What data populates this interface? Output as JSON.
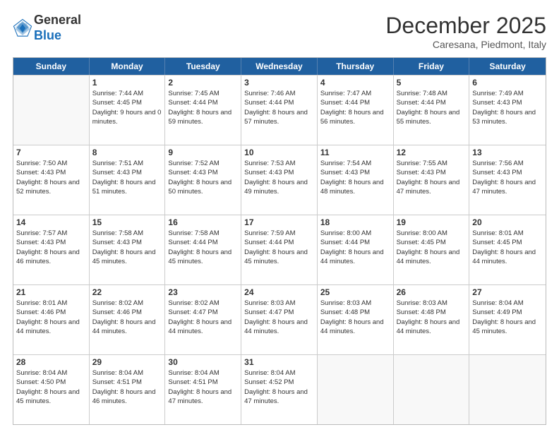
{
  "logo": {
    "general": "General",
    "blue": "Blue"
  },
  "header": {
    "month": "December 2025",
    "location": "Caresana, Piedmont, Italy"
  },
  "weekdays": [
    "Sunday",
    "Monday",
    "Tuesday",
    "Wednesday",
    "Thursday",
    "Friday",
    "Saturday"
  ],
  "rows": [
    [
      {
        "day": "",
        "sunrise": "",
        "sunset": "",
        "daylight": ""
      },
      {
        "day": "1",
        "sunrise": "Sunrise: 7:44 AM",
        "sunset": "Sunset: 4:45 PM",
        "daylight": "Daylight: 9 hours and 0 minutes."
      },
      {
        "day": "2",
        "sunrise": "Sunrise: 7:45 AM",
        "sunset": "Sunset: 4:44 PM",
        "daylight": "Daylight: 8 hours and 59 minutes."
      },
      {
        "day": "3",
        "sunrise": "Sunrise: 7:46 AM",
        "sunset": "Sunset: 4:44 PM",
        "daylight": "Daylight: 8 hours and 57 minutes."
      },
      {
        "day": "4",
        "sunrise": "Sunrise: 7:47 AM",
        "sunset": "Sunset: 4:44 PM",
        "daylight": "Daylight: 8 hours and 56 minutes."
      },
      {
        "day": "5",
        "sunrise": "Sunrise: 7:48 AM",
        "sunset": "Sunset: 4:44 PM",
        "daylight": "Daylight: 8 hours and 55 minutes."
      },
      {
        "day": "6",
        "sunrise": "Sunrise: 7:49 AM",
        "sunset": "Sunset: 4:43 PM",
        "daylight": "Daylight: 8 hours and 53 minutes."
      }
    ],
    [
      {
        "day": "7",
        "sunrise": "Sunrise: 7:50 AM",
        "sunset": "Sunset: 4:43 PM",
        "daylight": "Daylight: 8 hours and 52 minutes."
      },
      {
        "day": "8",
        "sunrise": "Sunrise: 7:51 AM",
        "sunset": "Sunset: 4:43 PM",
        "daylight": "Daylight: 8 hours and 51 minutes."
      },
      {
        "day": "9",
        "sunrise": "Sunrise: 7:52 AM",
        "sunset": "Sunset: 4:43 PM",
        "daylight": "Daylight: 8 hours and 50 minutes."
      },
      {
        "day": "10",
        "sunrise": "Sunrise: 7:53 AM",
        "sunset": "Sunset: 4:43 PM",
        "daylight": "Daylight: 8 hours and 49 minutes."
      },
      {
        "day": "11",
        "sunrise": "Sunrise: 7:54 AM",
        "sunset": "Sunset: 4:43 PM",
        "daylight": "Daylight: 8 hours and 48 minutes."
      },
      {
        "day": "12",
        "sunrise": "Sunrise: 7:55 AM",
        "sunset": "Sunset: 4:43 PM",
        "daylight": "Daylight: 8 hours and 47 minutes."
      },
      {
        "day": "13",
        "sunrise": "Sunrise: 7:56 AM",
        "sunset": "Sunset: 4:43 PM",
        "daylight": "Daylight: 8 hours and 47 minutes."
      }
    ],
    [
      {
        "day": "14",
        "sunrise": "Sunrise: 7:57 AM",
        "sunset": "Sunset: 4:43 PM",
        "daylight": "Daylight: 8 hours and 46 minutes."
      },
      {
        "day": "15",
        "sunrise": "Sunrise: 7:58 AM",
        "sunset": "Sunset: 4:43 PM",
        "daylight": "Daylight: 8 hours and 45 minutes."
      },
      {
        "day": "16",
        "sunrise": "Sunrise: 7:58 AM",
        "sunset": "Sunset: 4:44 PM",
        "daylight": "Daylight: 8 hours and 45 minutes."
      },
      {
        "day": "17",
        "sunrise": "Sunrise: 7:59 AM",
        "sunset": "Sunset: 4:44 PM",
        "daylight": "Daylight: 8 hours and 45 minutes."
      },
      {
        "day": "18",
        "sunrise": "Sunrise: 8:00 AM",
        "sunset": "Sunset: 4:44 PM",
        "daylight": "Daylight: 8 hours and 44 minutes."
      },
      {
        "day": "19",
        "sunrise": "Sunrise: 8:00 AM",
        "sunset": "Sunset: 4:45 PM",
        "daylight": "Daylight: 8 hours and 44 minutes."
      },
      {
        "day": "20",
        "sunrise": "Sunrise: 8:01 AM",
        "sunset": "Sunset: 4:45 PM",
        "daylight": "Daylight: 8 hours and 44 minutes."
      }
    ],
    [
      {
        "day": "21",
        "sunrise": "Sunrise: 8:01 AM",
        "sunset": "Sunset: 4:46 PM",
        "daylight": "Daylight: 8 hours and 44 minutes."
      },
      {
        "day": "22",
        "sunrise": "Sunrise: 8:02 AM",
        "sunset": "Sunset: 4:46 PM",
        "daylight": "Daylight: 8 hours and 44 minutes."
      },
      {
        "day": "23",
        "sunrise": "Sunrise: 8:02 AM",
        "sunset": "Sunset: 4:47 PM",
        "daylight": "Daylight: 8 hours and 44 minutes."
      },
      {
        "day": "24",
        "sunrise": "Sunrise: 8:03 AM",
        "sunset": "Sunset: 4:47 PM",
        "daylight": "Daylight: 8 hours and 44 minutes."
      },
      {
        "day": "25",
        "sunrise": "Sunrise: 8:03 AM",
        "sunset": "Sunset: 4:48 PM",
        "daylight": "Daylight: 8 hours and 44 minutes."
      },
      {
        "day": "26",
        "sunrise": "Sunrise: 8:03 AM",
        "sunset": "Sunset: 4:48 PM",
        "daylight": "Daylight: 8 hours and 44 minutes."
      },
      {
        "day": "27",
        "sunrise": "Sunrise: 8:04 AM",
        "sunset": "Sunset: 4:49 PM",
        "daylight": "Daylight: 8 hours and 45 minutes."
      }
    ],
    [
      {
        "day": "28",
        "sunrise": "Sunrise: 8:04 AM",
        "sunset": "Sunset: 4:50 PM",
        "daylight": "Daylight: 8 hours and 45 minutes."
      },
      {
        "day": "29",
        "sunrise": "Sunrise: 8:04 AM",
        "sunset": "Sunset: 4:51 PM",
        "daylight": "Daylight: 8 hours and 46 minutes."
      },
      {
        "day": "30",
        "sunrise": "Sunrise: 8:04 AM",
        "sunset": "Sunset: 4:51 PM",
        "daylight": "Daylight: 8 hours and 47 minutes."
      },
      {
        "day": "31",
        "sunrise": "Sunrise: 8:04 AM",
        "sunset": "Sunset: 4:52 PM",
        "daylight": "Daylight: 8 hours and 47 minutes."
      },
      {
        "day": "",
        "sunrise": "",
        "sunset": "",
        "daylight": ""
      },
      {
        "day": "",
        "sunrise": "",
        "sunset": "",
        "daylight": ""
      },
      {
        "day": "",
        "sunrise": "",
        "sunset": "",
        "daylight": ""
      }
    ]
  ]
}
